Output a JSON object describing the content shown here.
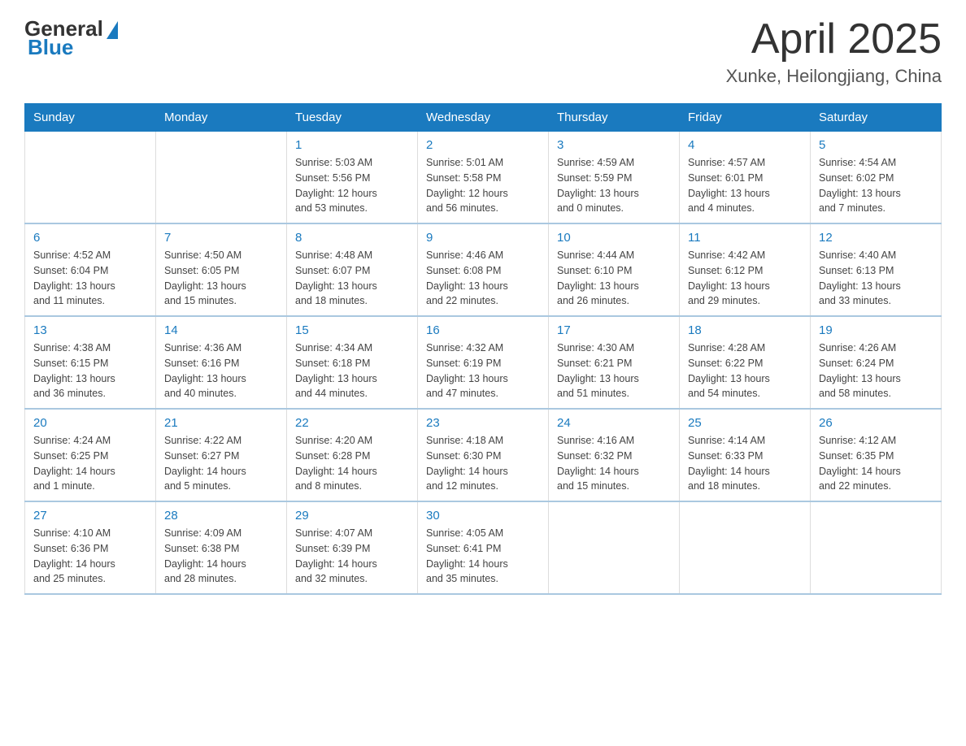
{
  "header": {
    "logo_general": "General",
    "logo_blue": "Blue",
    "month_title": "April 2025",
    "location": "Xunke, Heilongjiang, China"
  },
  "weekdays": [
    "Sunday",
    "Monday",
    "Tuesday",
    "Wednesday",
    "Thursday",
    "Friday",
    "Saturday"
  ],
  "weeks": [
    [
      {
        "day": "",
        "info": ""
      },
      {
        "day": "",
        "info": ""
      },
      {
        "day": "1",
        "info": "Sunrise: 5:03 AM\nSunset: 5:56 PM\nDaylight: 12 hours\nand 53 minutes."
      },
      {
        "day": "2",
        "info": "Sunrise: 5:01 AM\nSunset: 5:58 PM\nDaylight: 12 hours\nand 56 minutes."
      },
      {
        "day": "3",
        "info": "Sunrise: 4:59 AM\nSunset: 5:59 PM\nDaylight: 13 hours\nand 0 minutes."
      },
      {
        "day": "4",
        "info": "Sunrise: 4:57 AM\nSunset: 6:01 PM\nDaylight: 13 hours\nand 4 minutes."
      },
      {
        "day": "5",
        "info": "Sunrise: 4:54 AM\nSunset: 6:02 PM\nDaylight: 13 hours\nand 7 minutes."
      }
    ],
    [
      {
        "day": "6",
        "info": "Sunrise: 4:52 AM\nSunset: 6:04 PM\nDaylight: 13 hours\nand 11 minutes."
      },
      {
        "day": "7",
        "info": "Sunrise: 4:50 AM\nSunset: 6:05 PM\nDaylight: 13 hours\nand 15 minutes."
      },
      {
        "day": "8",
        "info": "Sunrise: 4:48 AM\nSunset: 6:07 PM\nDaylight: 13 hours\nand 18 minutes."
      },
      {
        "day": "9",
        "info": "Sunrise: 4:46 AM\nSunset: 6:08 PM\nDaylight: 13 hours\nand 22 minutes."
      },
      {
        "day": "10",
        "info": "Sunrise: 4:44 AM\nSunset: 6:10 PM\nDaylight: 13 hours\nand 26 minutes."
      },
      {
        "day": "11",
        "info": "Sunrise: 4:42 AM\nSunset: 6:12 PM\nDaylight: 13 hours\nand 29 minutes."
      },
      {
        "day": "12",
        "info": "Sunrise: 4:40 AM\nSunset: 6:13 PM\nDaylight: 13 hours\nand 33 minutes."
      }
    ],
    [
      {
        "day": "13",
        "info": "Sunrise: 4:38 AM\nSunset: 6:15 PM\nDaylight: 13 hours\nand 36 minutes."
      },
      {
        "day": "14",
        "info": "Sunrise: 4:36 AM\nSunset: 6:16 PM\nDaylight: 13 hours\nand 40 minutes."
      },
      {
        "day": "15",
        "info": "Sunrise: 4:34 AM\nSunset: 6:18 PM\nDaylight: 13 hours\nand 44 minutes."
      },
      {
        "day": "16",
        "info": "Sunrise: 4:32 AM\nSunset: 6:19 PM\nDaylight: 13 hours\nand 47 minutes."
      },
      {
        "day": "17",
        "info": "Sunrise: 4:30 AM\nSunset: 6:21 PM\nDaylight: 13 hours\nand 51 minutes."
      },
      {
        "day": "18",
        "info": "Sunrise: 4:28 AM\nSunset: 6:22 PM\nDaylight: 13 hours\nand 54 minutes."
      },
      {
        "day": "19",
        "info": "Sunrise: 4:26 AM\nSunset: 6:24 PM\nDaylight: 13 hours\nand 58 minutes."
      }
    ],
    [
      {
        "day": "20",
        "info": "Sunrise: 4:24 AM\nSunset: 6:25 PM\nDaylight: 14 hours\nand 1 minute."
      },
      {
        "day": "21",
        "info": "Sunrise: 4:22 AM\nSunset: 6:27 PM\nDaylight: 14 hours\nand 5 minutes."
      },
      {
        "day": "22",
        "info": "Sunrise: 4:20 AM\nSunset: 6:28 PM\nDaylight: 14 hours\nand 8 minutes."
      },
      {
        "day": "23",
        "info": "Sunrise: 4:18 AM\nSunset: 6:30 PM\nDaylight: 14 hours\nand 12 minutes."
      },
      {
        "day": "24",
        "info": "Sunrise: 4:16 AM\nSunset: 6:32 PM\nDaylight: 14 hours\nand 15 minutes."
      },
      {
        "day": "25",
        "info": "Sunrise: 4:14 AM\nSunset: 6:33 PM\nDaylight: 14 hours\nand 18 minutes."
      },
      {
        "day": "26",
        "info": "Sunrise: 4:12 AM\nSunset: 6:35 PM\nDaylight: 14 hours\nand 22 minutes."
      }
    ],
    [
      {
        "day": "27",
        "info": "Sunrise: 4:10 AM\nSunset: 6:36 PM\nDaylight: 14 hours\nand 25 minutes."
      },
      {
        "day": "28",
        "info": "Sunrise: 4:09 AM\nSunset: 6:38 PM\nDaylight: 14 hours\nand 28 minutes."
      },
      {
        "day": "29",
        "info": "Sunrise: 4:07 AM\nSunset: 6:39 PM\nDaylight: 14 hours\nand 32 minutes."
      },
      {
        "day": "30",
        "info": "Sunrise: 4:05 AM\nSunset: 6:41 PM\nDaylight: 14 hours\nand 35 minutes."
      },
      {
        "day": "",
        "info": ""
      },
      {
        "day": "",
        "info": ""
      },
      {
        "day": "",
        "info": ""
      }
    ]
  ]
}
